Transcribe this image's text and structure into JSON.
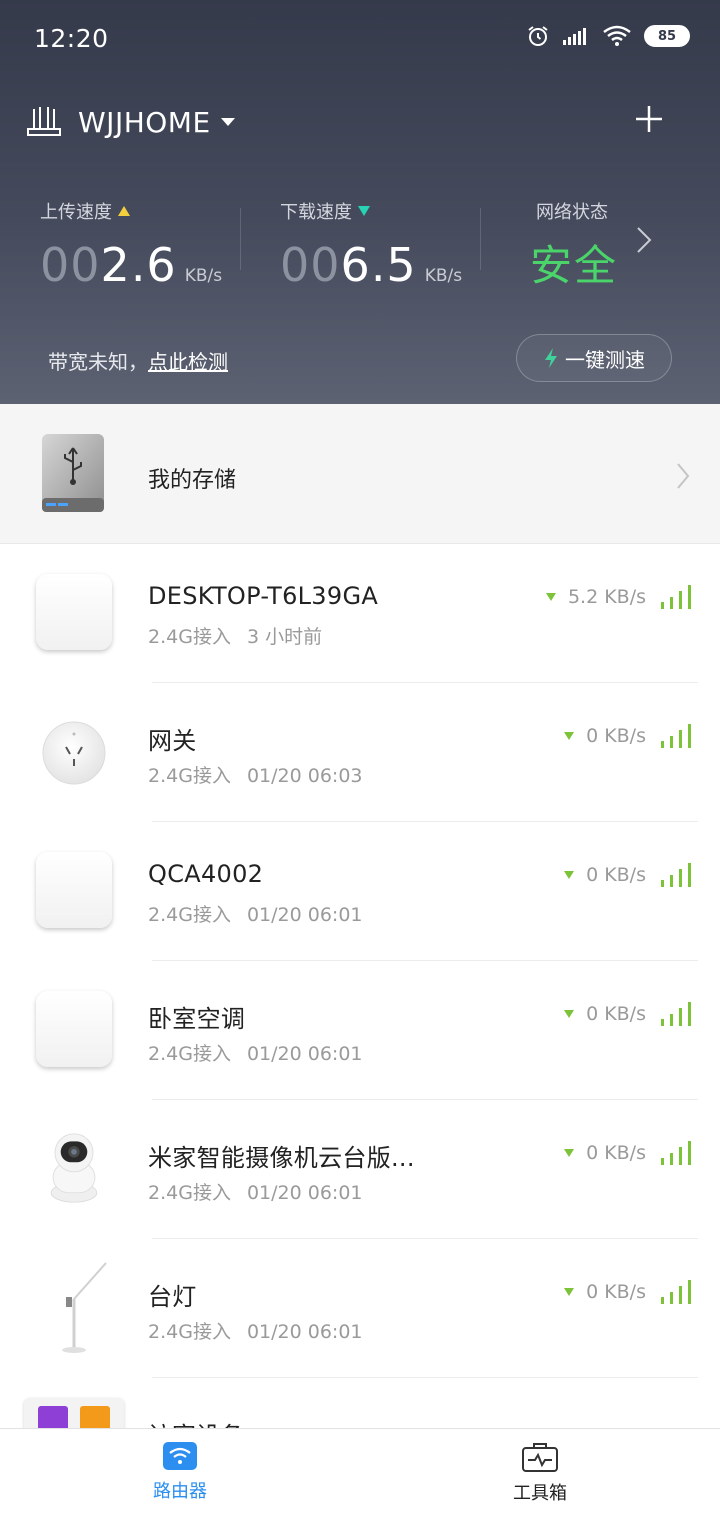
{
  "status_bar": {
    "time": "12:20",
    "battery": "85"
  },
  "header": {
    "router_name": "WJJHOME",
    "upload": {
      "label": "上传速度",
      "prefix": "00",
      "value": "2.6",
      "unit": "KB/s"
    },
    "download": {
      "label": "下载速度",
      "prefix": "00",
      "value": "6.5",
      "unit": "KB/s"
    },
    "network": {
      "label": "网络状态",
      "value": "安全"
    },
    "bandwidth": {
      "text": "带宽未知，",
      "link": "点此检测"
    },
    "speedtest_label": "一键测速"
  },
  "storage": {
    "label": "我的存储"
  },
  "devices": [
    {
      "name": "DESKTOP-T6L39GA",
      "band": "2.4G接入",
      "time": "3 小时前",
      "speed": "5.2 KB/s",
      "icon": "tile-icon"
    },
    {
      "name": "网关",
      "band": "2.4G接入",
      "time": "01/20 06:03",
      "speed": "0 KB/s",
      "icon": "gateway-icon"
    },
    {
      "name": "QCA4002",
      "band": "2.4G接入",
      "time": "01/20 06:01",
      "speed": "0 KB/s",
      "icon": "tile-icon"
    },
    {
      "name": "卧室空调",
      "band": "2.4G接入",
      "time": "01/20 06:01",
      "speed": "0 KB/s",
      "icon": "tile-icon"
    },
    {
      "name": "米家智能摄像机云台版...",
      "band": "2.4G接入",
      "time": "01/20 06:01",
      "speed": "0 KB/s",
      "icon": "camera-icon"
    },
    {
      "name": "台灯",
      "band": "2.4G接入",
      "time": "01/20 06:01",
      "speed": "0 KB/s",
      "icon": "lamp-icon"
    }
  ],
  "partial_device": {
    "label": "访客设备"
  },
  "bottom_nav": {
    "router_label": "路由器",
    "toolbox_label": "工具箱",
    "active_color": "#2c8ff0"
  },
  "colors": {
    "header_bg": "#353a4b",
    "secure_green": "#4ad46a",
    "signal_green": "#7cc33a"
  }
}
